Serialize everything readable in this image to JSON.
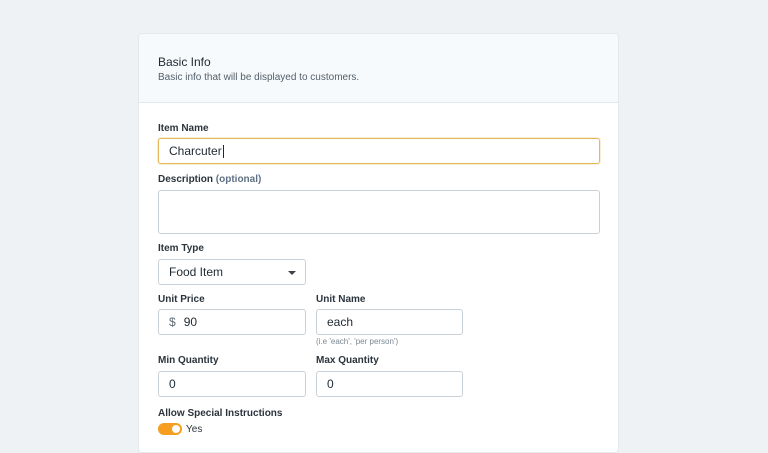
{
  "section": {
    "title": "Basic Info",
    "subtitle": "Basic info that will be displayed to customers."
  },
  "item_name": {
    "label": "Item Name",
    "value": "Charcuter"
  },
  "description": {
    "label": "Description",
    "optional_label": "(optional)",
    "value": ""
  },
  "item_type": {
    "label": "Item Type",
    "selected": "Food Item"
  },
  "unit_price": {
    "label": "Unit Price",
    "currency": "$",
    "value": "90"
  },
  "unit_name": {
    "label": "Unit Name",
    "value": "each",
    "hint": "(i.e 'each', 'per person')"
  },
  "min_quantity": {
    "label": "Min Quantity",
    "value": "0"
  },
  "max_quantity": {
    "label": "Max Quantity",
    "value": "0"
  },
  "special_instructions": {
    "label": "Allow Special Instructions",
    "toggle_label": "Yes",
    "enabled": true
  },
  "colors": {
    "accent": "#f59e1f",
    "focus_border": "#e6b85c",
    "background": "#eef2f5"
  }
}
